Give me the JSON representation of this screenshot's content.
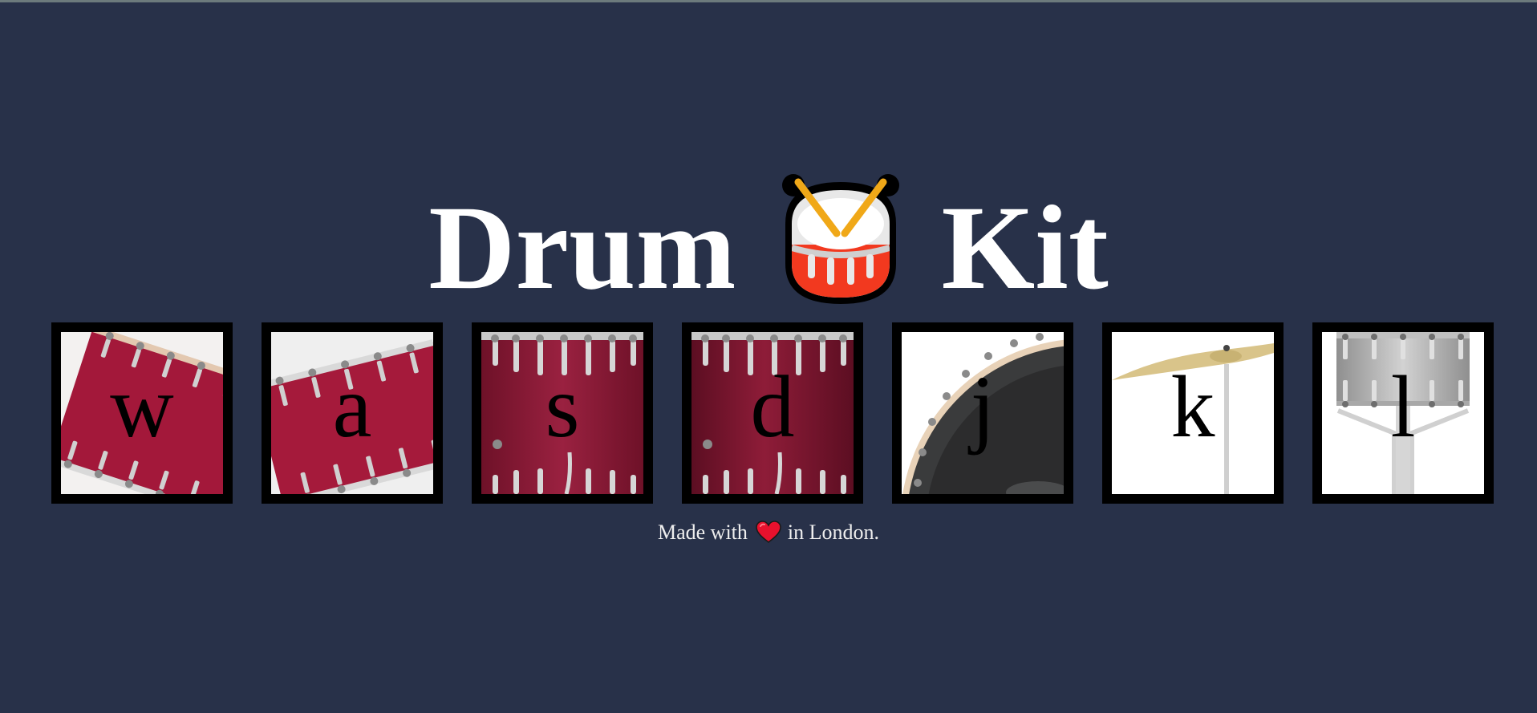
{
  "title": {
    "left": "Drum",
    "right": "Kit",
    "emoji_icon": "drum-emoji-icon"
  },
  "colors": {
    "background": "#283149",
    "title": "#ffffff",
    "border": "#000000",
    "snare_red": "#a3183a",
    "tom_red": "#8c1a35",
    "kick_dark": "#2c2c2c",
    "cymbal_gold": "#d9c48a",
    "hihat_silver": "#b8b8b8"
  },
  "drums": [
    {
      "key": "w",
      "icon": "tilted-snare-drum-icon"
    },
    {
      "key": "a",
      "icon": "tilted-tom-drum-icon"
    },
    {
      "key": "s",
      "icon": "floor-tom-drum-icon"
    },
    {
      "key": "d",
      "icon": "floor-tom-drum-icon"
    },
    {
      "key": "j",
      "icon": "kick-drum-icon"
    },
    {
      "key": "k",
      "icon": "crash-cymbal-icon"
    },
    {
      "key": "l",
      "icon": "hi-hat-icon"
    }
  ],
  "footer": {
    "before": "Made with",
    "after": "in London.",
    "heart_icon": "heart-icon"
  }
}
